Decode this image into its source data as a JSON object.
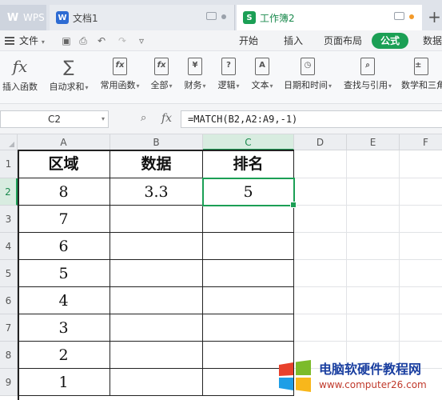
{
  "tabs": {
    "wps": "WPS",
    "doc": "文档1",
    "book": "工作簿2",
    "book_glyph": "S",
    "doc_glyph": "W"
  },
  "menu": {
    "file": "文件",
    "ribbon_tabs": [
      "开始",
      "插入",
      "页面布局",
      "公式",
      "数据"
    ],
    "active_tab": "公式"
  },
  "ribbon": {
    "buttons": [
      {
        "label": "插入函数",
        "icon": "fx"
      },
      {
        "label": "自动求和",
        "icon": "∑"
      },
      {
        "label": "常用函数",
        "icon": "fx"
      },
      {
        "label": "全部",
        "icon": "fx"
      },
      {
        "label": "财务",
        "icon": "¥"
      },
      {
        "label": "逻辑",
        "icon": "?"
      },
      {
        "label": "文本",
        "icon": "A"
      },
      {
        "label": "日期和时间",
        "icon": "◷"
      },
      {
        "label": "查找与引用",
        "icon": "⌕"
      },
      {
        "label": "数学和三角",
        "icon": "±"
      }
    ]
  },
  "formula_bar": {
    "name_box": "C2",
    "formula": "=MATCH(B2,A2:A9,-1)"
  },
  "grid": {
    "columns": [
      "A",
      "B",
      "C",
      "D",
      "E",
      "F"
    ],
    "rows": [
      "1",
      "2",
      "3",
      "4",
      "5",
      "6",
      "7",
      "8",
      "9"
    ],
    "header": [
      "区域",
      "数据",
      "排名"
    ],
    "col_a": [
      "8",
      "7",
      "6",
      "5",
      "4",
      "3",
      "2",
      "1"
    ],
    "col_b": [
      "3.3"
    ],
    "col_c": [
      "5"
    ],
    "active_cell": "C2"
  },
  "watermark": {
    "title": "电脑软硬件教程网",
    "url": "www.computer26.com"
  },
  "colors": {
    "accent": "#1b9f55",
    "tab_bar": "#dfe3ea",
    "watermark_title": "#1a3fa0",
    "watermark_url": "#c0392b"
  }
}
